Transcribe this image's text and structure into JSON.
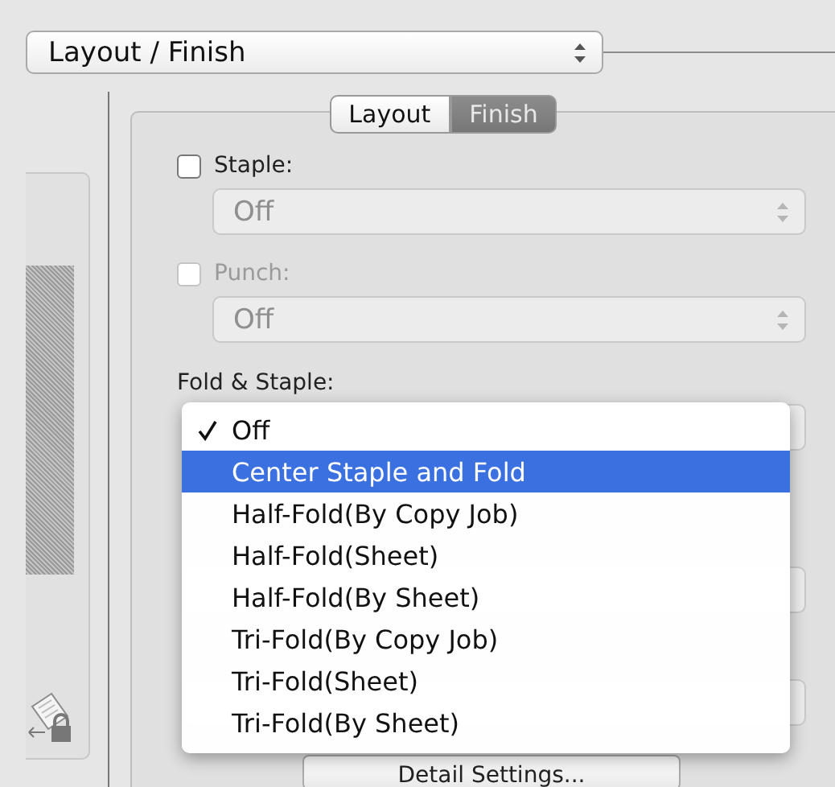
{
  "page_selector": {
    "value": "Layout / Finish"
  },
  "tabs": [
    {
      "label": "Layout",
      "selected": false
    },
    {
      "label": "Finish",
      "selected": true
    }
  ],
  "options": [
    {
      "label": "Staple:",
      "checked": false,
      "disabled": false,
      "value": "Off"
    },
    {
      "label": "Punch:",
      "checked": false,
      "disabled": true,
      "value": "Off"
    }
  ],
  "fold_staple": {
    "label": "Fold & Staple:",
    "menu": [
      {
        "label": "Off",
        "checked": true,
        "selected": false
      },
      {
        "label": "Center Staple and Fold",
        "checked": false,
        "selected": true
      },
      {
        "label": "Half-Fold(By Copy Job)",
        "checked": false,
        "selected": false
      },
      {
        "label": "Half-Fold(Sheet)",
        "checked": false,
        "selected": false
      },
      {
        "label": "Half-Fold(By Sheet)",
        "checked": false,
        "selected": false
      },
      {
        "label": "Tri-Fold(By Copy Job)",
        "checked": false,
        "selected": false
      },
      {
        "label": "Tri-Fold(Sheet)",
        "checked": false,
        "selected": false
      },
      {
        "label": "Tri-Fold(By Sheet)",
        "checked": false,
        "selected": false
      }
    ]
  },
  "detail_button": "Detail Settings..."
}
